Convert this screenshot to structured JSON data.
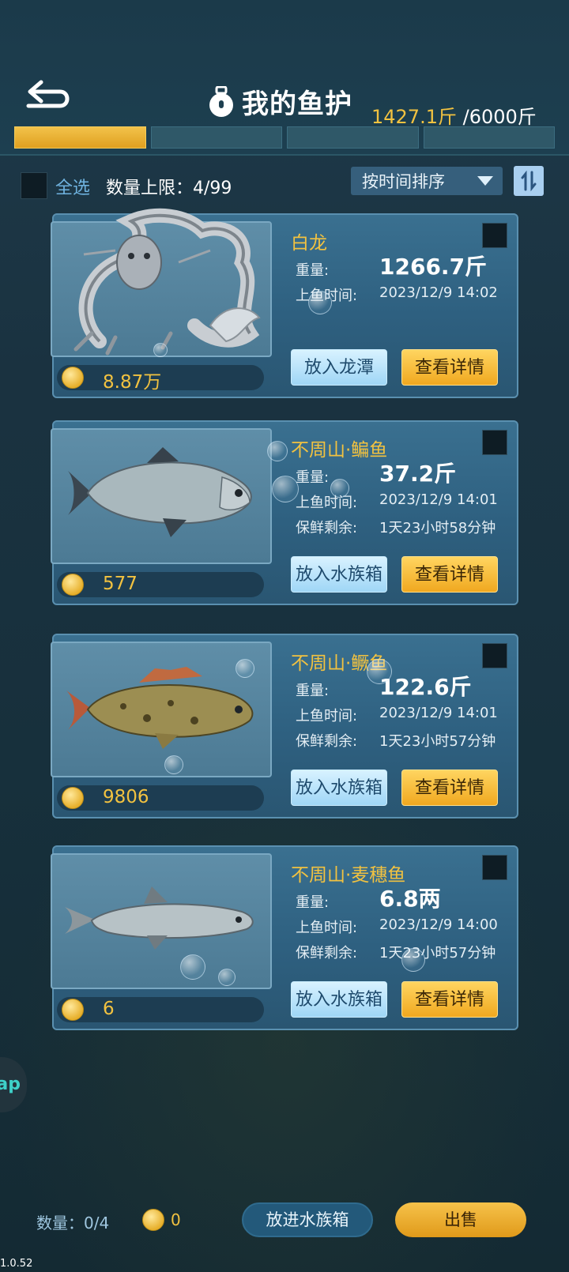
{
  "header": {
    "title": "我的鱼护",
    "capacity_current": "1427.1斤",
    "capacity_max": "/6000斤",
    "progress_segments": [
      true,
      false,
      false,
      false
    ]
  },
  "toolbar": {
    "select_all": "全选",
    "limit": "数量上限：4/99",
    "sort": "按时间排序"
  },
  "labels": {
    "weight": "重量:",
    "catch_time": "上鱼时间:",
    "fresh": "保鲜剩余:"
  },
  "cards": [
    {
      "name": "白龙",
      "weight": "1266.7斤",
      "catch_time": "2023/12/9  14:02",
      "fresh": "",
      "price": "8.87万",
      "action": "放入龙潭",
      "detail": "查看详情"
    },
    {
      "name": "不周山·鳊鱼",
      "weight": "37.2斤",
      "catch_time": "2023/12/9  14:01",
      "fresh": "1天23小时58分钟",
      "price": "577",
      "action": "放入水族箱",
      "detail": "查看详情"
    },
    {
      "name": "不周山·鳜鱼",
      "weight": "122.6斤",
      "catch_time": "2023/12/9  14:01",
      "fresh": "1天23小时57分钟",
      "price": "9806",
      "action": "放入水族箱",
      "detail": "查看详情"
    },
    {
      "name": "不周山·麦穗鱼",
      "weight": "6.8两",
      "catch_time": "2023/12/9  14:00",
      "fresh": "1天23小时57分钟",
      "price": "6",
      "action": "放入水族箱",
      "detail": "查看详情"
    }
  ],
  "bottom": {
    "qty": "数量：0/4",
    "coins": "0",
    "put_label": "放进水族箱",
    "sell_label": "出售"
  },
  "side_tab": "ap",
  "version": "1.0.52"
}
